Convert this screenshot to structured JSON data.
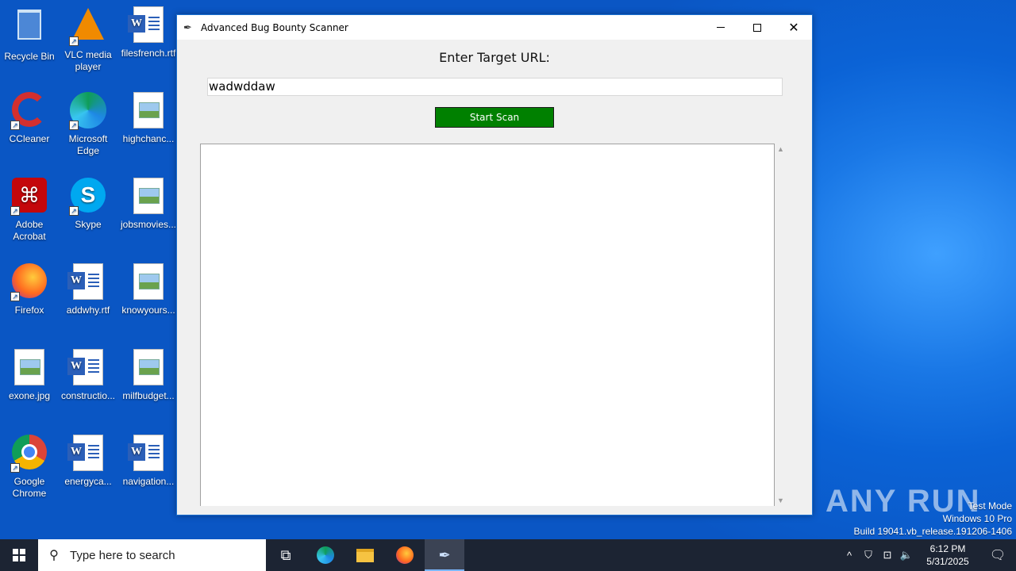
{
  "desktop": {
    "icons": [
      {
        "label": "Recycle Bin"
      },
      {
        "label": "VLC media player"
      },
      {
        "label": "filesfrench.rtf"
      },
      {
        "label": "CCleaner"
      },
      {
        "label": "Microsoft Edge"
      },
      {
        "label": "highchanc..."
      },
      {
        "label": "Adobe Acrobat"
      },
      {
        "label": "Skype"
      },
      {
        "label": "jobsmovies..."
      },
      {
        "label": "Firefox"
      },
      {
        "label": "addwhy.rtf"
      },
      {
        "label": "knowyours..."
      },
      {
        "label": "exone.jpg"
      },
      {
        "label": "constructio..."
      },
      {
        "label": "milfbudget..."
      },
      {
        "label": "Google Chrome"
      },
      {
        "label": "energyca..."
      },
      {
        "label": "navigation..."
      }
    ]
  },
  "window": {
    "title": "Advanced Bug Bounty Scanner",
    "url_label": "Enter Target URL:",
    "url_value": "wadwddaw",
    "scan_button": "Start Scan",
    "output_text": "",
    "scan_button_color": "#008000"
  },
  "watermark": {
    "brand": "ANY RUN",
    "line1": "Test Mode",
    "line2": "Windows 10 Pro",
    "line3": "Build 19041.vb_release.191206-1406"
  },
  "taskbar": {
    "search_placeholder": "Type here to search",
    "time": "6:12 PM",
    "date": "5/31/2025"
  }
}
